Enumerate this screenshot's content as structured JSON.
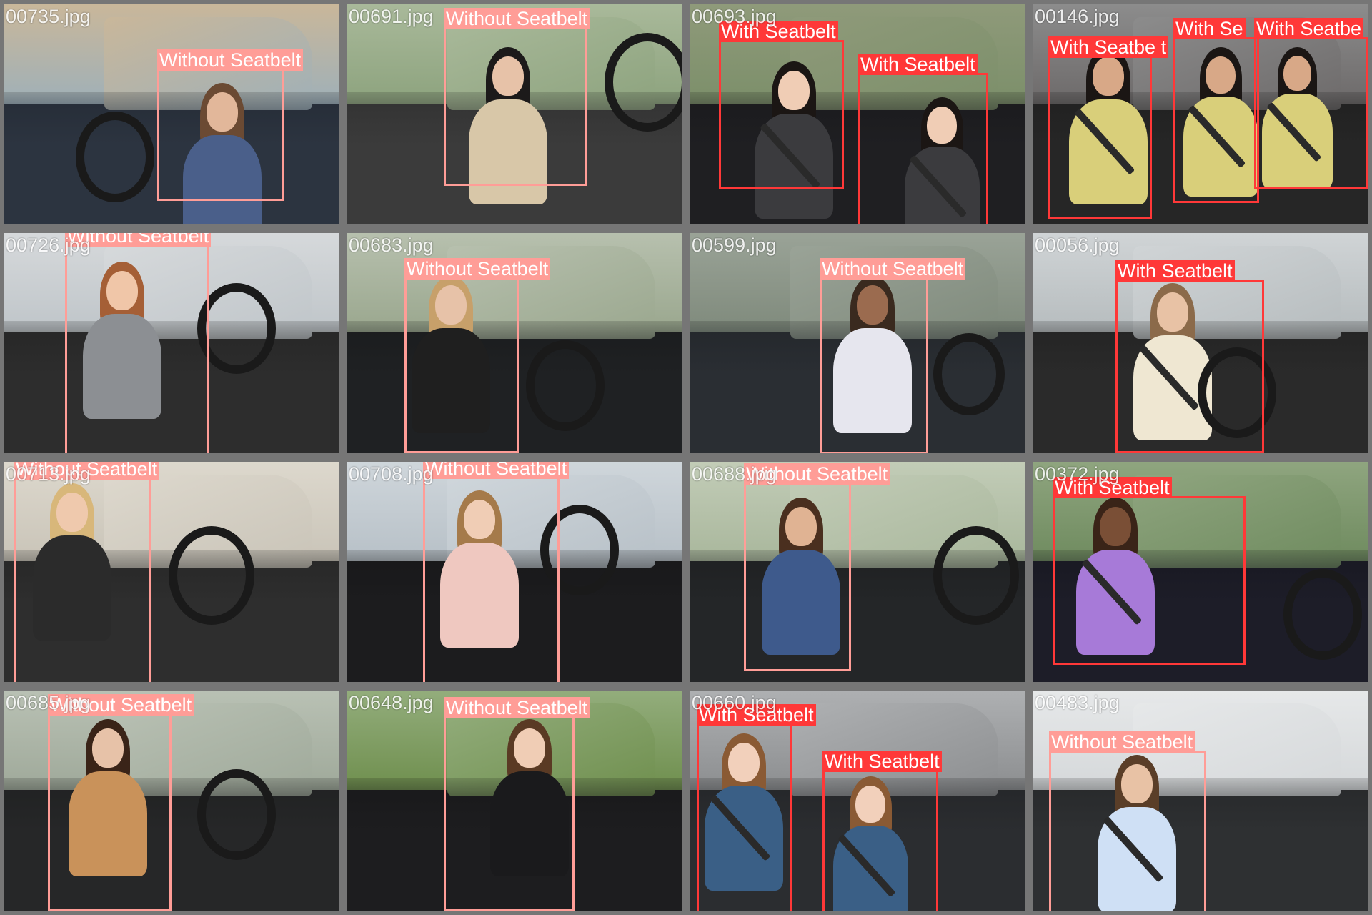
{
  "mosaic": {
    "tiles": [
      {
        "filename": "00735.jpg",
        "palette": {
          "sky": "#9fb0b8",
          "cabin": "#2c3440",
          "window": "#c9b79a",
          "skin": "#e2b79a",
          "hair": "#6b4a33",
          "shirt": "#4a5f8a"
        },
        "detections": [
          {
            "label": "Without Seatbelt",
            "class": "no"
          }
        ]
      },
      {
        "filename": "00691.jpg",
        "palette": {
          "sky": "#8da37e",
          "cabin": "#3b3b3b",
          "window": "#a9b99a",
          "skin": "#e7c2a8",
          "hair": "#1c1a1a",
          "shirt": "#d8c7a8"
        },
        "detections": [
          {
            "label": "Without Seatbelt",
            "class": "no"
          }
        ]
      },
      {
        "filename": "00693.jpg",
        "palette": {
          "sky": "#7c8f6a",
          "cabin": "#1f1f22",
          "window": "#8f9a7a",
          "skin": "#f0cdb5",
          "hair": "#1b1614",
          "shirt": "#3b3b3e"
        },
        "detections": [
          {
            "label": "With Seatbelt",
            "class": "yes"
          },
          {
            "label": "With Seatbelt",
            "class": "yes"
          }
        ]
      },
      {
        "filename": "00146.jpg",
        "palette": {
          "sky": "#6d6a6a",
          "cabin": "#262626",
          "window": "#8c8c8c",
          "skin": "#d8a887",
          "hair": "#1b1614",
          "shirt": "#d9cf7a"
        },
        "detections": [
          {
            "label": "With Seatbe t",
            "class": "yes"
          },
          {
            "label": "With Se",
            "class": "yes"
          },
          {
            "label": "With Seatbe",
            "class": "yes"
          }
        ]
      },
      {
        "filename": "00726.jpg",
        "palette": {
          "sky": "#bfc5c9",
          "cabin": "#2d2d2d",
          "window": "#d6d9db",
          "skin": "#f0c6a8",
          "hair": "#a55f36",
          "shirt": "#8c8f93"
        },
        "detections": [
          {
            "label": "Without Seatbelt",
            "class": "no"
          }
        ]
      },
      {
        "filename": "00683.jpg",
        "palette": {
          "sky": "#9aa78e",
          "cabin": "#1f2123",
          "window": "#b7c0ae",
          "skin": "#e7c2a8",
          "hair": "#c7a06a",
          "shirt": "#1f1f1f"
        },
        "detections": [
          {
            "label": "Without Seatbelt",
            "class": "no"
          }
        ]
      },
      {
        "filename": "00599.jpg",
        "palette": {
          "sky": "#7f8a7c",
          "cabin": "#2a2e33",
          "window": "#9aa397",
          "skin": "#9b6b4f",
          "hair": "#3a2a1f",
          "shirt": "#e6e6ee"
        },
        "detections": [
          {
            "label": "Without Seatbelt",
            "class": "no"
          }
        ]
      },
      {
        "filename": "00056.jpg",
        "palette": {
          "sky": "#b6bcbe",
          "cabin": "#2a2a2a",
          "window": "#d0d4d6",
          "skin": "#e8c2a5",
          "hair": "#8b6a4a",
          "shirt": "#efe7d2"
        },
        "detections": [
          {
            "label": "With Seatbelt",
            "class": "yes"
          }
        ]
      },
      {
        "filename": "00713.jpg",
        "palette": {
          "sky": "#c9c4b8",
          "cabin": "#2e2e2e",
          "window": "#ddd8cd",
          "skin": "#efc9ad",
          "hair": "#d8b77a",
          "shirt": "#2b2b2b"
        },
        "detections": [
          {
            "label": "Without Seatbelt",
            "class": "no"
          }
        ]
      },
      {
        "filename": "00708.jpg",
        "palette": {
          "sky": "#b7c0c7",
          "cabin": "#1c1c1e",
          "window": "#cfd6db",
          "skin": "#f0cdb5",
          "hair": "#a57a4a",
          "shirt": "#efc8c0"
        },
        "detections": [
          {
            "label": "Without Seatbelt",
            "class": "no"
          }
        ]
      },
      {
        "filename": "00688.jpg",
        "palette": {
          "sky": "#a9b79c",
          "cabin": "#242628",
          "window": "#c2ccb7",
          "skin": "#e0b393",
          "hair": "#4a2f1f",
          "shirt": "#3e5a8c"
        },
        "detections": [
          {
            "label": "Without Seatbelt",
            "class": "no"
          }
        ]
      },
      {
        "filename": "00372.jpg",
        "palette": {
          "sky": "#6f8b5f",
          "cabin": "#1d1d28",
          "window": "#8fa57f",
          "skin": "#7a4f36",
          "hair": "#3a2418",
          "shirt": "#a77ad8"
        },
        "detections": [
          {
            "label": "With Seatbelt",
            "class": "yes"
          }
        ]
      },
      {
        "filename": "00685.jpg",
        "palette": {
          "sky": "#9fa99a",
          "cabin": "#262728",
          "window": "#b9c1b4",
          "skin": "#e7c2a8",
          "hair": "#3a2418",
          "shirt": "#c9925a"
        },
        "detections": [
          {
            "label": "Without Seatbelt",
            "class": "no"
          }
        ]
      },
      {
        "filename": "00648.jpg",
        "palette": {
          "sky": "#6f8f4e",
          "cabin": "#1d1d1f",
          "window": "#93ad7c",
          "skin": "#f0cdb5",
          "hair": "#5a3a24",
          "shirt": "#1a1a1c"
        },
        "detections": [
          {
            "label": "Without Seatbelt",
            "class": "no"
          }
        ]
      },
      {
        "filename": "00660.jpg",
        "palette": {
          "sky": "#8c8e90",
          "cabin": "#2b2d30",
          "window": "#aeb0b2",
          "skin": "#f2d0bb",
          "hair": "#8a5a34",
          "shirt": "#3a5f86"
        },
        "detections": [
          {
            "label": "With Seatbelt",
            "class": "yes"
          },
          {
            "label": "With Seatbelt",
            "class": "yes"
          }
        ]
      },
      {
        "filename": "00483.jpg",
        "palette": {
          "sky": "#d5d8da",
          "cabin": "#2e3032",
          "window": "#e6e8e9",
          "skin": "#e8c2a5",
          "hair": "#5a3e28",
          "shirt": "#cfe0f5"
        },
        "detections": [
          {
            "label": "Without Seatbelt",
            "class": "no"
          }
        ]
      }
    ]
  }
}
